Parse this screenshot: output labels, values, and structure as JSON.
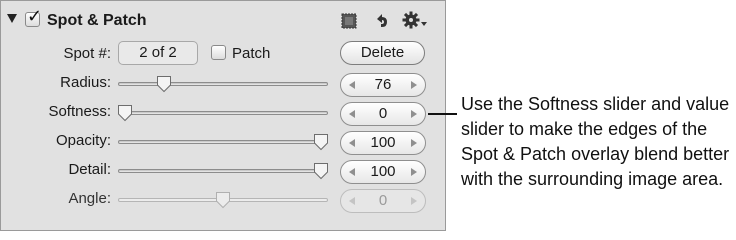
{
  "panel": {
    "title": "Spot & Patch",
    "enabled": true,
    "spot_label": "Spot #:",
    "spot_value": "2 of 2",
    "patch_label": "Patch",
    "patch_checked": false,
    "delete_label": "Delete",
    "icons": [
      "brush-icon",
      "reset-arrow-icon",
      "gear-dropdown-icon"
    ]
  },
  "sliders": [
    {
      "label": "Radius:",
      "value": "76",
      "level": 0.2,
      "enabled": true
    },
    {
      "label": "Softness:",
      "value": "0",
      "level": 0.0,
      "enabled": true
    },
    {
      "label": "Opacity:",
      "value": "100",
      "level": 1.0,
      "enabled": true
    },
    {
      "label": "Detail:",
      "value": "100",
      "level": 1.0,
      "enabled": true
    },
    {
      "label": "Angle:",
      "value": "0",
      "level": 0.5,
      "enabled": false
    }
  ],
  "callout": {
    "text": "Use the Softness slider and value slider to make the edges of the Spot & Patch overlay blend better with the surrounding image area."
  }
}
